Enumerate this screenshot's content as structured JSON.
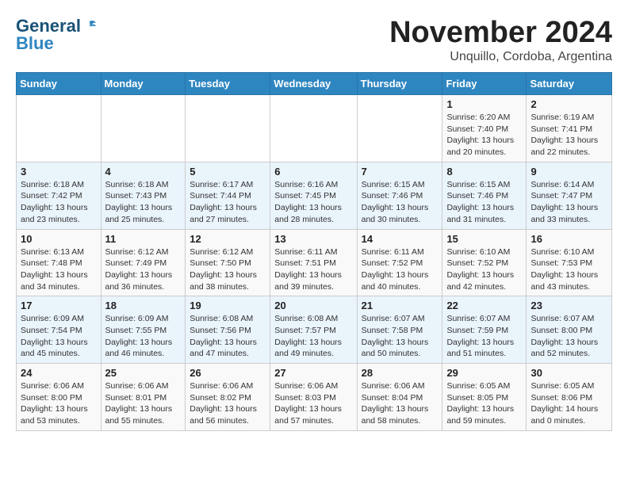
{
  "logo": {
    "line1": "General",
    "line2": "Blue"
  },
  "title": "November 2024",
  "location": "Unquillo, Cordoba, Argentina",
  "weekdays": [
    "Sunday",
    "Monday",
    "Tuesday",
    "Wednesday",
    "Thursday",
    "Friday",
    "Saturday"
  ],
  "weeks": [
    [
      {
        "day": "",
        "info": ""
      },
      {
        "day": "",
        "info": ""
      },
      {
        "day": "",
        "info": ""
      },
      {
        "day": "",
        "info": ""
      },
      {
        "day": "",
        "info": ""
      },
      {
        "day": "1",
        "info": "Sunrise: 6:20 AM\nSunset: 7:40 PM\nDaylight: 13 hours\nand 20 minutes."
      },
      {
        "day": "2",
        "info": "Sunrise: 6:19 AM\nSunset: 7:41 PM\nDaylight: 13 hours\nand 22 minutes."
      }
    ],
    [
      {
        "day": "3",
        "info": "Sunrise: 6:18 AM\nSunset: 7:42 PM\nDaylight: 13 hours\nand 23 minutes."
      },
      {
        "day": "4",
        "info": "Sunrise: 6:18 AM\nSunset: 7:43 PM\nDaylight: 13 hours\nand 25 minutes."
      },
      {
        "day": "5",
        "info": "Sunrise: 6:17 AM\nSunset: 7:44 PM\nDaylight: 13 hours\nand 27 minutes."
      },
      {
        "day": "6",
        "info": "Sunrise: 6:16 AM\nSunset: 7:45 PM\nDaylight: 13 hours\nand 28 minutes."
      },
      {
        "day": "7",
        "info": "Sunrise: 6:15 AM\nSunset: 7:46 PM\nDaylight: 13 hours\nand 30 minutes."
      },
      {
        "day": "8",
        "info": "Sunrise: 6:15 AM\nSunset: 7:46 PM\nDaylight: 13 hours\nand 31 minutes."
      },
      {
        "day": "9",
        "info": "Sunrise: 6:14 AM\nSunset: 7:47 PM\nDaylight: 13 hours\nand 33 minutes."
      }
    ],
    [
      {
        "day": "10",
        "info": "Sunrise: 6:13 AM\nSunset: 7:48 PM\nDaylight: 13 hours\nand 34 minutes."
      },
      {
        "day": "11",
        "info": "Sunrise: 6:12 AM\nSunset: 7:49 PM\nDaylight: 13 hours\nand 36 minutes."
      },
      {
        "day": "12",
        "info": "Sunrise: 6:12 AM\nSunset: 7:50 PM\nDaylight: 13 hours\nand 38 minutes."
      },
      {
        "day": "13",
        "info": "Sunrise: 6:11 AM\nSunset: 7:51 PM\nDaylight: 13 hours\nand 39 minutes."
      },
      {
        "day": "14",
        "info": "Sunrise: 6:11 AM\nSunset: 7:52 PM\nDaylight: 13 hours\nand 40 minutes."
      },
      {
        "day": "15",
        "info": "Sunrise: 6:10 AM\nSunset: 7:52 PM\nDaylight: 13 hours\nand 42 minutes."
      },
      {
        "day": "16",
        "info": "Sunrise: 6:10 AM\nSunset: 7:53 PM\nDaylight: 13 hours\nand 43 minutes."
      }
    ],
    [
      {
        "day": "17",
        "info": "Sunrise: 6:09 AM\nSunset: 7:54 PM\nDaylight: 13 hours\nand 45 minutes."
      },
      {
        "day": "18",
        "info": "Sunrise: 6:09 AM\nSunset: 7:55 PM\nDaylight: 13 hours\nand 46 minutes."
      },
      {
        "day": "19",
        "info": "Sunrise: 6:08 AM\nSunset: 7:56 PM\nDaylight: 13 hours\nand 47 minutes."
      },
      {
        "day": "20",
        "info": "Sunrise: 6:08 AM\nSunset: 7:57 PM\nDaylight: 13 hours\nand 49 minutes."
      },
      {
        "day": "21",
        "info": "Sunrise: 6:07 AM\nSunset: 7:58 PM\nDaylight: 13 hours\nand 50 minutes."
      },
      {
        "day": "22",
        "info": "Sunrise: 6:07 AM\nSunset: 7:59 PM\nDaylight: 13 hours\nand 51 minutes."
      },
      {
        "day": "23",
        "info": "Sunrise: 6:07 AM\nSunset: 8:00 PM\nDaylight: 13 hours\nand 52 minutes."
      }
    ],
    [
      {
        "day": "24",
        "info": "Sunrise: 6:06 AM\nSunset: 8:00 PM\nDaylight: 13 hours\nand 53 minutes."
      },
      {
        "day": "25",
        "info": "Sunrise: 6:06 AM\nSunset: 8:01 PM\nDaylight: 13 hours\nand 55 minutes."
      },
      {
        "day": "26",
        "info": "Sunrise: 6:06 AM\nSunset: 8:02 PM\nDaylight: 13 hours\nand 56 minutes."
      },
      {
        "day": "27",
        "info": "Sunrise: 6:06 AM\nSunset: 8:03 PM\nDaylight: 13 hours\nand 57 minutes."
      },
      {
        "day": "28",
        "info": "Sunrise: 6:06 AM\nSunset: 8:04 PM\nDaylight: 13 hours\nand 58 minutes."
      },
      {
        "day": "29",
        "info": "Sunrise: 6:05 AM\nSunset: 8:05 PM\nDaylight: 13 hours\nand 59 minutes."
      },
      {
        "day": "30",
        "info": "Sunrise: 6:05 AM\nSunset: 8:06 PM\nDaylight: 14 hours\nand 0 minutes."
      }
    ]
  ]
}
